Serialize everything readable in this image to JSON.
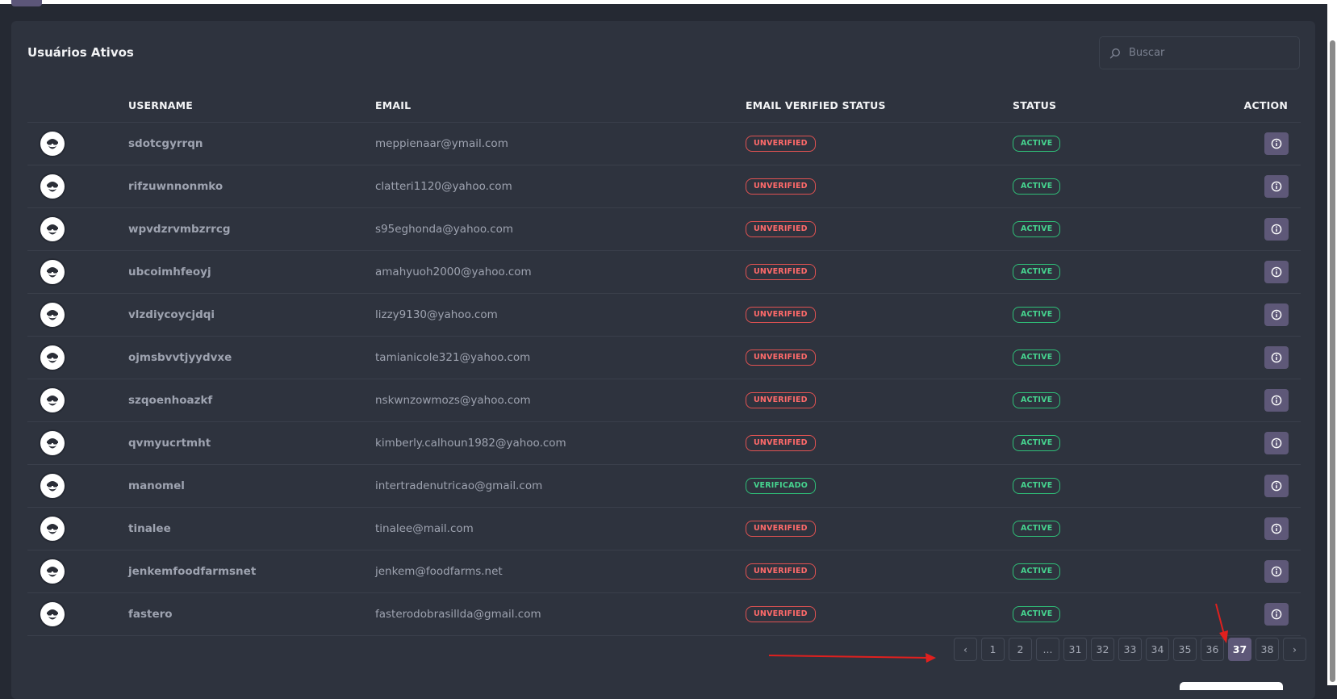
{
  "card": {
    "title": "Usuários Ativos",
    "search_placeholder": "Buscar"
  },
  "table": {
    "headers": {
      "username": "USERNAME",
      "email": "EMAIL",
      "email_verified": "EMAIL VERIFIED STATUS",
      "status": "STATUS",
      "action": "ACTION"
    },
    "rows": [
      {
        "username": "sdotcgyrrqn",
        "email": "meppienaar@ymail.com",
        "verified": "UNVERIFIED",
        "status": "ACTIVE"
      },
      {
        "username": "rifzuwnnonmko",
        "email": "clatteri1120@yahoo.com",
        "verified": "UNVERIFIED",
        "status": "ACTIVE"
      },
      {
        "username": "wpvdzrvmbzrrcg",
        "email": "s95eghonda@yahoo.com",
        "verified": "UNVERIFIED",
        "status": "ACTIVE"
      },
      {
        "username": "ubcoimhfeoyj",
        "email": "amahyuoh2000@yahoo.com",
        "verified": "UNVERIFIED",
        "status": "ACTIVE"
      },
      {
        "username": "vlzdiycoycjdqi",
        "email": "lizzy9130@yahoo.com",
        "verified": "UNVERIFIED",
        "status": "ACTIVE"
      },
      {
        "username": "ojmsbvvtjyydvxe",
        "email": "tamianicole321@yahoo.com",
        "verified": "UNVERIFIED",
        "status": "ACTIVE"
      },
      {
        "username": "szqoenhoazkf",
        "email": "nskwnzowmozs@yahoo.com",
        "verified": "UNVERIFIED",
        "status": "ACTIVE"
      },
      {
        "username": "qvmyucrtmht",
        "email": "kimberly.calhoun1982@yahoo.com",
        "verified": "UNVERIFIED",
        "status": "ACTIVE"
      },
      {
        "username": "manomel",
        "email": "intertradenutricao@gmail.com",
        "verified": "VERIFICADO",
        "status": "ACTIVE"
      },
      {
        "username": "tinalee",
        "email": "tinalee@mail.com",
        "verified": "UNVERIFIED",
        "status": "ACTIVE"
      },
      {
        "username": "jenkemfoodfarmsnet",
        "email": "jenkem@foodfarms.net",
        "verified": "UNVERIFIED",
        "status": "ACTIVE"
      },
      {
        "username": "fastero",
        "email": "fasterodobrasillda@gmail.com",
        "verified": "UNVERIFIED",
        "status": "ACTIVE"
      }
    ]
  },
  "pagination": {
    "prev": "‹",
    "next": "›",
    "pages": [
      "1",
      "2",
      "...",
      "31",
      "32",
      "33",
      "34",
      "35",
      "36",
      "37",
      "38"
    ],
    "current": "37"
  },
  "colors": {
    "background": "#252933",
    "card": "#2e333e",
    "accent": "#5e5878",
    "unverified": "#ff6a6a",
    "verified": "#46d48f",
    "annotation_arrow": "#e0201e"
  },
  "icons": {
    "search": "search-icon",
    "avatar": "user-avatar-icon",
    "info": "info-icon"
  }
}
